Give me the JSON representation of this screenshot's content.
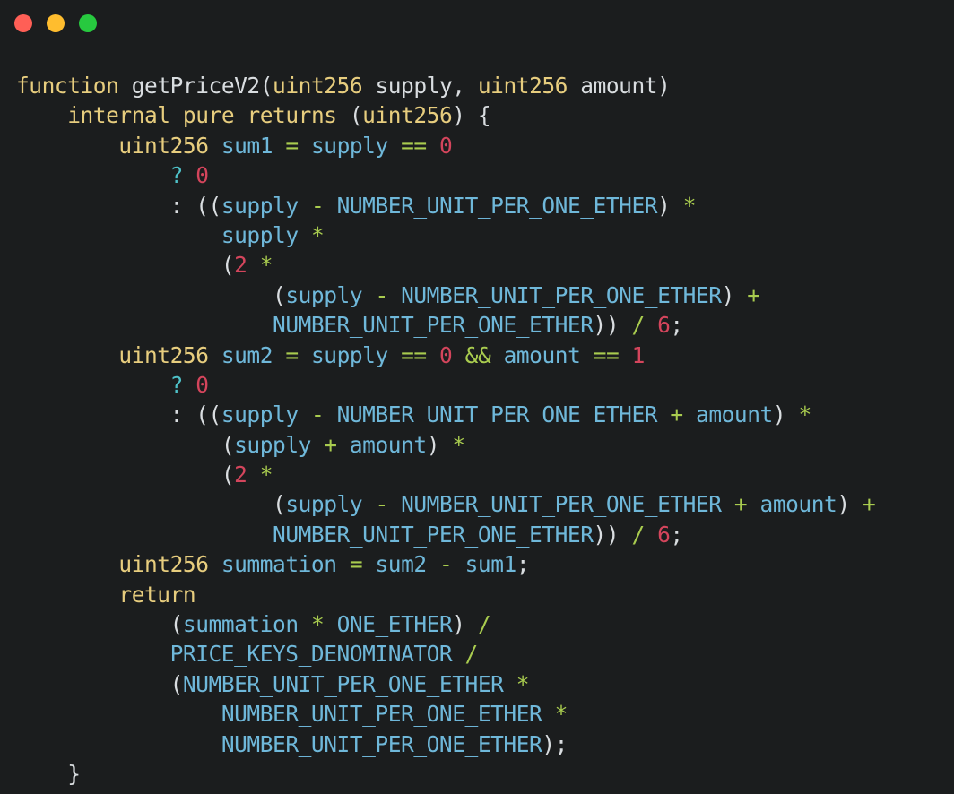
{
  "window": {
    "title": "",
    "traffic_lights": [
      {
        "name": "close",
        "color": "#ff5f56"
      },
      {
        "name": "minimize",
        "color": "#ffbd2e"
      },
      {
        "name": "maximize",
        "color": "#27c93f"
      }
    ],
    "background": "#1b1d1e"
  },
  "theme": {
    "keyword": "#e7cd7e",
    "type": "#e7cd7e",
    "function_name": "#d9dde0",
    "variable": "#6fb8da",
    "constant": "#6fb8da",
    "operator": "#a9cc4f",
    "number": "#d4455c",
    "punctuation": "#d9dde0",
    "conditional": "#4ec2c9"
  },
  "code": {
    "language": "solidity",
    "plain_text": "function getPriceV2(uint256 supply, uint256 amount)\n    internal pure returns (uint256) {\n        uint256 sum1 = supply == 0\n            ? 0\n            : ((supply - NUMBER_UNIT_PER_ONE_ETHER) *\n                supply *\n                (2 *\n                    (supply - NUMBER_UNIT_PER_ONE_ETHER) +\n                    NUMBER_UNIT_PER_ONE_ETHER)) / 6;\n        uint256 sum2 = supply == 0 && amount == 1\n            ? 0\n            : ((supply - NUMBER_UNIT_PER_ONE_ETHER + amount) *\n                (supply + amount) *\n                (2 *\n                    (supply - NUMBER_UNIT_PER_ONE_ETHER + amount) +\n                    NUMBER_UNIT_PER_ONE_ETHER)) / 6;\n        uint256 summation = sum2 - sum1;\n        return\n            (summation * ONE_ETHER) /\n            PRICE_KEYS_DENOMINATOR /\n            (NUMBER_UNIT_PER_ONE_ETHER *\n                NUMBER_UNIT_PER_ONE_ETHER *\n                NUMBER_UNIT_PER_ONE_ETHER);\n    }",
    "lines": [
      {
        "n": 1,
        "tokens": [
          {
            "t": "function",
            "c": "kw"
          },
          {
            "t": " ",
            "c": "plain"
          },
          {
            "t": "getPriceV2",
            "c": "fn"
          },
          {
            "t": "(",
            "c": "punc"
          },
          {
            "t": "uint256",
            "c": "type"
          },
          {
            "t": " supply",
            "c": "plain"
          },
          {
            "t": ", ",
            "c": "punc"
          },
          {
            "t": "uint256",
            "c": "type"
          },
          {
            "t": " amount",
            "c": "plain"
          },
          {
            "t": ")",
            "c": "punc"
          }
        ]
      },
      {
        "n": 2,
        "tokens": [
          {
            "t": "    ",
            "c": "plain"
          },
          {
            "t": "internal",
            "c": "kw"
          },
          {
            "t": " ",
            "c": "plain"
          },
          {
            "t": "pure",
            "c": "kw"
          },
          {
            "t": " ",
            "c": "plain"
          },
          {
            "t": "returns",
            "c": "kw"
          },
          {
            "t": " ",
            "c": "plain"
          },
          {
            "t": "(",
            "c": "punc"
          },
          {
            "t": "uint256",
            "c": "type"
          },
          {
            "t": ") {",
            "c": "punc"
          }
        ]
      },
      {
        "n": 3,
        "tokens": [
          {
            "t": "        ",
            "c": "plain"
          },
          {
            "t": "uint256",
            "c": "type"
          },
          {
            "t": " ",
            "c": "plain"
          },
          {
            "t": "sum1",
            "c": "var"
          },
          {
            "t": " ",
            "c": "plain"
          },
          {
            "t": "=",
            "c": "op"
          },
          {
            "t": " ",
            "c": "plain"
          },
          {
            "t": "supply",
            "c": "var"
          },
          {
            "t": " ",
            "c": "plain"
          },
          {
            "t": "==",
            "c": "op"
          },
          {
            "t": " ",
            "c": "plain"
          },
          {
            "t": "0",
            "c": "num"
          }
        ]
      },
      {
        "n": 4,
        "tokens": [
          {
            "t": "            ",
            "c": "plain"
          },
          {
            "t": "?",
            "c": "cond"
          },
          {
            "t": " ",
            "c": "plain"
          },
          {
            "t": "0",
            "c": "num"
          }
        ]
      },
      {
        "n": 5,
        "tokens": [
          {
            "t": "            ",
            "c": "plain"
          },
          {
            "t": ":",
            "c": "punc"
          },
          {
            "t": " ((",
            "c": "punc"
          },
          {
            "t": "supply",
            "c": "var"
          },
          {
            "t": " ",
            "c": "plain"
          },
          {
            "t": "-",
            "c": "op"
          },
          {
            "t": " ",
            "c": "plain"
          },
          {
            "t": "NUMBER_UNIT_PER_ONE_ETHER",
            "c": "const"
          },
          {
            "t": ")",
            "c": "punc"
          },
          {
            "t": " ",
            "c": "plain"
          },
          {
            "t": "*",
            "c": "op"
          }
        ]
      },
      {
        "n": 6,
        "tokens": [
          {
            "t": "                ",
            "c": "plain"
          },
          {
            "t": "supply",
            "c": "var"
          },
          {
            "t": " ",
            "c": "plain"
          },
          {
            "t": "*",
            "c": "op"
          }
        ]
      },
      {
        "n": 7,
        "tokens": [
          {
            "t": "                ",
            "c": "plain"
          },
          {
            "t": "(",
            "c": "punc"
          },
          {
            "t": "2",
            "c": "num"
          },
          {
            "t": " ",
            "c": "plain"
          },
          {
            "t": "*",
            "c": "op"
          }
        ]
      },
      {
        "n": 8,
        "tokens": [
          {
            "t": "                    ",
            "c": "plain"
          },
          {
            "t": "(",
            "c": "punc"
          },
          {
            "t": "supply",
            "c": "var"
          },
          {
            "t": " ",
            "c": "plain"
          },
          {
            "t": "-",
            "c": "op"
          },
          {
            "t": " ",
            "c": "plain"
          },
          {
            "t": "NUMBER_UNIT_PER_ONE_ETHER",
            "c": "const"
          },
          {
            "t": ")",
            "c": "punc"
          },
          {
            "t": " ",
            "c": "plain"
          },
          {
            "t": "+",
            "c": "op"
          }
        ]
      },
      {
        "n": 9,
        "tokens": [
          {
            "t": "                    ",
            "c": "plain"
          },
          {
            "t": "NUMBER_UNIT_PER_ONE_ETHER",
            "c": "const"
          },
          {
            "t": "))",
            "c": "punc"
          },
          {
            "t": " ",
            "c": "plain"
          },
          {
            "t": "/",
            "c": "op"
          },
          {
            "t": " ",
            "c": "plain"
          },
          {
            "t": "6",
            "c": "num"
          },
          {
            "t": ";",
            "c": "punc"
          }
        ]
      },
      {
        "n": 10,
        "tokens": [
          {
            "t": "        ",
            "c": "plain"
          },
          {
            "t": "uint256",
            "c": "type"
          },
          {
            "t": " ",
            "c": "plain"
          },
          {
            "t": "sum2",
            "c": "var"
          },
          {
            "t": " ",
            "c": "plain"
          },
          {
            "t": "=",
            "c": "op"
          },
          {
            "t": " ",
            "c": "plain"
          },
          {
            "t": "supply",
            "c": "var"
          },
          {
            "t": " ",
            "c": "plain"
          },
          {
            "t": "==",
            "c": "op"
          },
          {
            "t": " ",
            "c": "plain"
          },
          {
            "t": "0",
            "c": "num"
          },
          {
            "t": " ",
            "c": "plain"
          },
          {
            "t": "&&",
            "c": "op"
          },
          {
            "t": " ",
            "c": "plain"
          },
          {
            "t": "amount",
            "c": "var"
          },
          {
            "t": " ",
            "c": "plain"
          },
          {
            "t": "==",
            "c": "op"
          },
          {
            "t": " ",
            "c": "plain"
          },
          {
            "t": "1",
            "c": "num"
          }
        ]
      },
      {
        "n": 11,
        "tokens": [
          {
            "t": "            ",
            "c": "plain"
          },
          {
            "t": "?",
            "c": "cond"
          },
          {
            "t": " ",
            "c": "plain"
          },
          {
            "t": "0",
            "c": "num"
          }
        ]
      },
      {
        "n": 12,
        "tokens": [
          {
            "t": "            ",
            "c": "plain"
          },
          {
            "t": ":",
            "c": "punc"
          },
          {
            "t": " ((",
            "c": "punc"
          },
          {
            "t": "supply",
            "c": "var"
          },
          {
            "t": " ",
            "c": "plain"
          },
          {
            "t": "-",
            "c": "op"
          },
          {
            "t": " ",
            "c": "plain"
          },
          {
            "t": "NUMBER_UNIT_PER_ONE_ETHER",
            "c": "const"
          },
          {
            "t": " ",
            "c": "plain"
          },
          {
            "t": "+",
            "c": "op"
          },
          {
            "t": " ",
            "c": "plain"
          },
          {
            "t": "amount",
            "c": "var"
          },
          {
            "t": ")",
            "c": "punc"
          },
          {
            "t": " ",
            "c": "plain"
          },
          {
            "t": "*",
            "c": "op"
          }
        ]
      },
      {
        "n": 13,
        "tokens": [
          {
            "t": "                ",
            "c": "plain"
          },
          {
            "t": "(",
            "c": "punc"
          },
          {
            "t": "supply",
            "c": "var"
          },
          {
            "t": " ",
            "c": "plain"
          },
          {
            "t": "+",
            "c": "op"
          },
          {
            "t": " ",
            "c": "plain"
          },
          {
            "t": "amount",
            "c": "var"
          },
          {
            "t": ")",
            "c": "punc"
          },
          {
            "t": " ",
            "c": "plain"
          },
          {
            "t": "*",
            "c": "op"
          }
        ]
      },
      {
        "n": 14,
        "tokens": [
          {
            "t": "                ",
            "c": "plain"
          },
          {
            "t": "(",
            "c": "punc"
          },
          {
            "t": "2",
            "c": "num"
          },
          {
            "t": " ",
            "c": "plain"
          },
          {
            "t": "*",
            "c": "op"
          }
        ]
      },
      {
        "n": 15,
        "tokens": [
          {
            "t": "                    ",
            "c": "plain"
          },
          {
            "t": "(",
            "c": "punc"
          },
          {
            "t": "supply",
            "c": "var"
          },
          {
            "t": " ",
            "c": "plain"
          },
          {
            "t": "-",
            "c": "op"
          },
          {
            "t": " ",
            "c": "plain"
          },
          {
            "t": "NUMBER_UNIT_PER_ONE_ETHER",
            "c": "const"
          },
          {
            "t": " ",
            "c": "plain"
          },
          {
            "t": "+",
            "c": "op"
          },
          {
            "t": " ",
            "c": "plain"
          },
          {
            "t": "amount",
            "c": "var"
          },
          {
            "t": ")",
            "c": "punc"
          },
          {
            "t": " ",
            "c": "plain"
          },
          {
            "t": "+",
            "c": "op"
          }
        ]
      },
      {
        "n": 16,
        "tokens": [
          {
            "t": "                    ",
            "c": "plain"
          },
          {
            "t": "NUMBER_UNIT_PER_ONE_ETHER",
            "c": "const"
          },
          {
            "t": "))",
            "c": "punc"
          },
          {
            "t": " ",
            "c": "plain"
          },
          {
            "t": "/",
            "c": "op"
          },
          {
            "t": " ",
            "c": "plain"
          },
          {
            "t": "6",
            "c": "num"
          },
          {
            "t": ";",
            "c": "punc"
          }
        ]
      },
      {
        "n": 17,
        "tokens": [
          {
            "t": "        ",
            "c": "plain"
          },
          {
            "t": "uint256",
            "c": "type"
          },
          {
            "t": " ",
            "c": "plain"
          },
          {
            "t": "summation",
            "c": "var"
          },
          {
            "t": " ",
            "c": "plain"
          },
          {
            "t": "=",
            "c": "op"
          },
          {
            "t": " ",
            "c": "plain"
          },
          {
            "t": "sum2",
            "c": "var"
          },
          {
            "t": " ",
            "c": "plain"
          },
          {
            "t": "-",
            "c": "op"
          },
          {
            "t": " ",
            "c": "plain"
          },
          {
            "t": "sum1",
            "c": "var"
          },
          {
            "t": ";",
            "c": "punc"
          }
        ]
      },
      {
        "n": 18,
        "tokens": [
          {
            "t": "        ",
            "c": "plain"
          },
          {
            "t": "return",
            "c": "kw"
          }
        ]
      },
      {
        "n": 19,
        "tokens": [
          {
            "t": "            ",
            "c": "plain"
          },
          {
            "t": "(",
            "c": "punc"
          },
          {
            "t": "summation",
            "c": "var"
          },
          {
            "t": " ",
            "c": "plain"
          },
          {
            "t": "*",
            "c": "op"
          },
          {
            "t": " ",
            "c": "plain"
          },
          {
            "t": "ONE_ETHER",
            "c": "const"
          },
          {
            "t": ")",
            "c": "punc"
          },
          {
            "t": " ",
            "c": "plain"
          },
          {
            "t": "/",
            "c": "op"
          }
        ]
      },
      {
        "n": 20,
        "tokens": [
          {
            "t": "            ",
            "c": "plain"
          },
          {
            "t": "PRICE_KEYS_DENOMINATOR",
            "c": "const"
          },
          {
            "t": " ",
            "c": "plain"
          },
          {
            "t": "/",
            "c": "op"
          }
        ]
      },
      {
        "n": 21,
        "tokens": [
          {
            "t": "            ",
            "c": "plain"
          },
          {
            "t": "(",
            "c": "punc"
          },
          {
            "t": "NUMBER_UNIT_PER_ONE_ETHER",
            "c": "const"
          },
          {
            "t": " ",
            "c": "plain"
          },
          {
            "t": "*",
            "c": "op"
          }
        ]
      },
      {
        "n": 22,
        "tokens": [
          {
            "t": "                ",
            "c": "plain"
          },
          {
            "t": "NUMBER_UNIT_PER_ONE_ETHER",
            "c": "const"
          },
          {
            "t": " ",
            "c": "plain"
          },
          {
            "t": "*",
            "c": "op"
          }
        ]
      },
      {
        "n": 23,
        "tokens": [
          {
            "t": "                ",
            "c": "plain"
          },
          {
            "t": "NUMBER_UNIT_PER_ONE_ETHER",
            "c": "const"
          },
          {
            "t": ");",
            "c": "punc"
          }
        ]
      },
      {
        "n": 24,
        "tokens": [
          {
            "t": "    ",
            "c": "plain"
          },
          {
            "t": "}",
            "c": "punc"
          }
        ]
      }
    ]
  }
}
